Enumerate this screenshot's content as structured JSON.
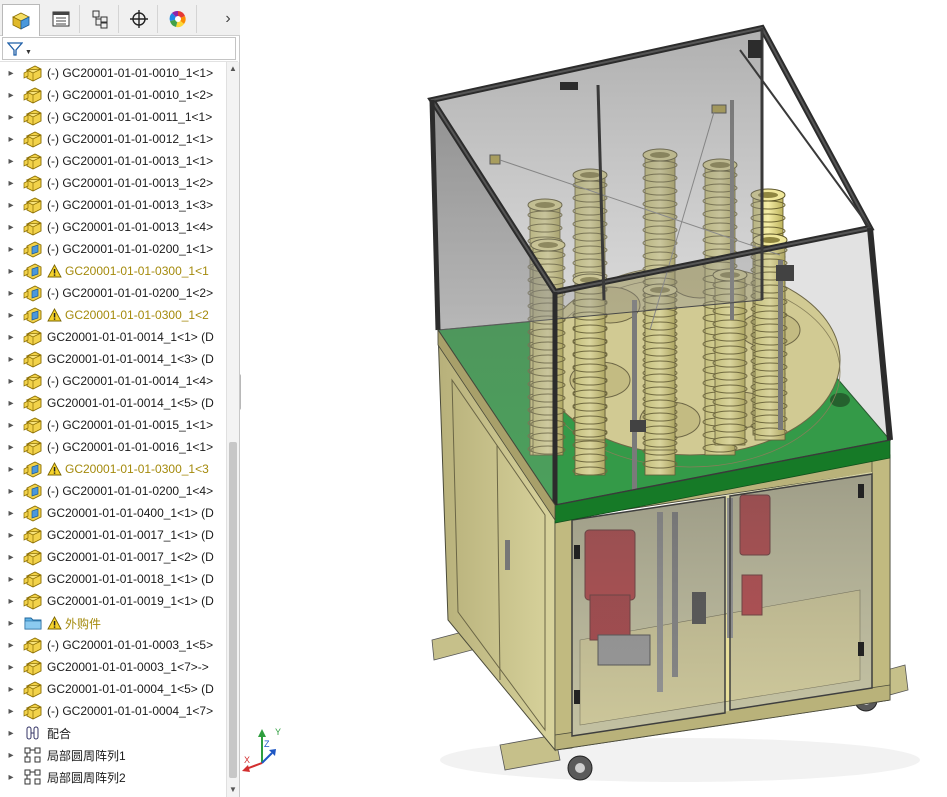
{
  "tabs": [
    {
      "name": "feature-manager",
      "icon": "assembly-cube-icon",
      "active": true
    },
    {
      "name": "property-manager",
      "icon": "property-list-icon",
      "active": false
    },
    {
      "name": "configuration-manager",
      "icon": "configuration-icon",
      "active": false
    },
    {
      "name": "dimxpert-manager",
      "icon": "crosshair-icon",
      "active": false
    },
    {
      "name": "display-manager",
      "icon": "color-wheel-icon",
      "active": false
    }
  ],
  "tree": [
    {
      "label": "(-) GC20001-01-01-0010_1<1> ",
      "icon": "part",
      "warning": false
    },
    {
      "label": "(-) GC20001-01-01-0010_1<2>",
      "icon": "part",
      "warning": false
    },
    {
      "label": "(-) GC20001-01-01-0011_1<1>",
      "icon": "part",
      "warning": false
    },
    {
      "label": "(-) GC20001-01-01-0012_1<1>",
      "icon": "part",
      "warning": false
    },
    {
      "label": "(-) GC20001-01-01-0013_1<1>",
      "icon": "part",
      "warning": false
    },
    {
      "label": "(-) GC20001-01-01-0013_1<2>",
      "icon": "part",
      "warning": false
    },
    {
      "label": "(-) GC20001-01-01-0013_1<3>",
      "icon": "part",
      "warning": false
    },
    {
      "label": "(-) GC20001-01-01-0013_1<4>",
      "icon": "part",
      "warning": false
    },
    {
      "label": "(-) GC20001-01-01-0200_1<1>",
      "icon": "subassembly",
      "warning": false
    },
    {
      "label": "GC20001-01-01-0300_1<1",
      "icon": "subassembly",
      "warning": true
    },
    {
      "label": "(-) GC20001-01-01-0200_1<2>",
      "icon": "subassembly",
      "warning": false
    },
    {
      "label": "GC20001-01-01-0300_1<2",
      "icon": "subassembly",
      "warning": true
    },
    {
      "label": "GC20001-01-01-0014_1<1> (D",
      "icon": "part",
      "warning": false
    },
    {
      "label": "GC20001-01-01-0014_1<3> (D",
      "icon": "part",
      "warning": false
    },
    {
      "label": "(-) GC20001-01-01-0014_1<4>",
      "icon": "part",
      "warning": false
    },
    {
      "label": "GC20001-01-01-0014_1<5> (D",
      "icon": "part",
      "warning": false
    },
    {
      "label": "(-) GC20001-01-01-0015_1<1>",
      "icon": "part",
      "warning": false
    },
    {
      "label": "(-) GC20001-01-01-0016_1<1>",
      "icon": "part",
      "warning": false
    },
    {
      "label": "GC20001-01-01-0300_1<3",
      "icon": "subassembly",
      "warning": true
    },
    {
      "label": "(-) GC20001-01-01-0200_1<4>",
      "icon": "subassembly",
      "warning": false
    },
    {
      "label": "GC20001-01-01-0400_1<1> (D",
      "icon": "subassembly",
      "warning": false
    },
    {
      "label": "GC20001-01-01-0017_1<1> (D",
      "icon": "part",
      "warning": false
    },
    {
      "label": "GC20001-01-01-0017_1<2> (D",
      "icon": "part",
      "warning": false
    },
    {
      "label": "GC20001-01-01-0018_1<1> (D",
      "icon": "part",
      "warning": false
    },
    {
      "label": "GC20001-01-01-0019_1<1> (D",
      "icon": "part",
      "warning": false
    },
    {
      "label": "外购件",
      "icon": "folder",
      "warning": true
    },
    {
      "label": "(-) GC20001-01-01-0003_1<5>",
      "icon": "part",
      "warning": false
    },
    {
      "label": "GC20001-01-01-0003_1<7>->",
      "icon": "part",
      "warning": false
    },
    {
      "label": "GC20001-01-01-0004_1<5> (D",
      "icon": "part",
      "warning": false
    },
    {
      "label": "(-) GC20001-01-01-0004_1<7>",
      "icon": "part",
      "warning": false
    },
    {
      "label": "配合",
      "icon": "mates",
      "warning": false
    },
    {
      "label": "局部圆周阵列1",
      "icon": "pattern",
      "warning": false
    },
    {
      "label": "局部圆周阵列2",
      "icon": "pattern",
      "warning": false
    }
  ],
  "triad": {
    "x": "X",
    "y": "Y",
    "z": "Z"
  },
  "colors": {
    "part_yellow": "#f2d24a",
    "assembly_blue": "#3f8fd8",
    "warning_text": "#a48a0c",
    "frame_khaki": "#b9b27a",
    "plate_green": "#21a33a",
    "motor_red": "#c3262a",
    "glass": "#8a8a8a"
  }
}
